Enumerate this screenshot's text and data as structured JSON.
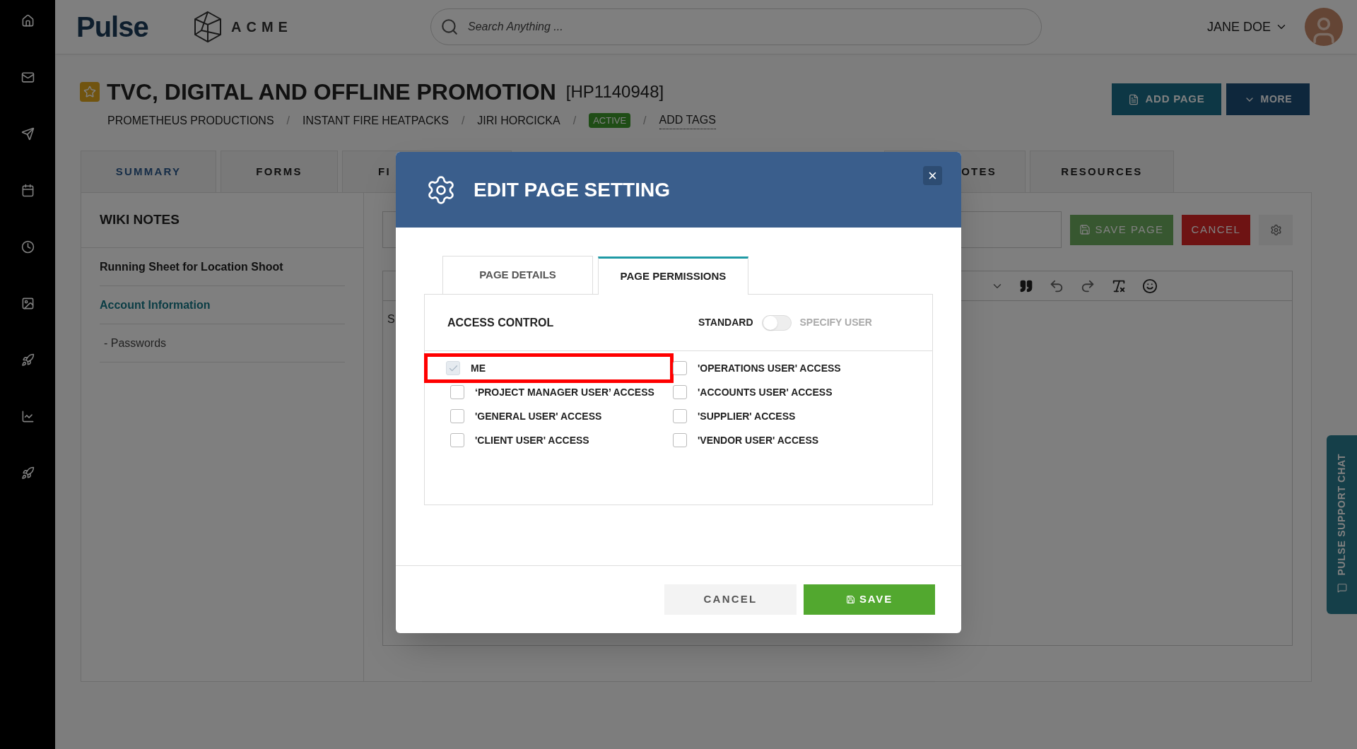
{
  "header": {
    "logo": "Pulse",
    "brand": "ACME",
    "search": {
      "placeholder": "Search Anything ..."
    },
    "user": "JANE DOE"
  },
  "page": {
    "title": "TVC, DIGITAL AND OFFLINE PROMOTION",
    "code": "[HP1140948]",
    "separator": "/",
    "breadcrumbs": [
      {
        "kind": "text",
        "label": "PROMETHEUS PRODUCTIONS"
      },
      {
        "kind": "text",
        "label": "INSTANT FIRE HEATPACKS"
      },
      {
        "kind": "text",
        "label": "JIRI HORCICKA"
      },
      {
        "kind": "badge",
        "label": "ACTIVE"
      },
      {
        "kind": "link",
        "label": "ADD TAGS"
      }
    ],
    "actions": [
      "ADD PAGE",
      "MORE"
    ]
  },
  "tabs": [
    {
      "label": "SUMMARY",
      "selected": true,
      "kind": "full"
    },
    {
      "label": "FORMS",
      "selected": false,
      "kind": "full"
    },
    {
      "label": "FI",
      "selected": false,
      "kind": "cut-right"
    },
    {
      "label": "OTES",
      "selected": false,
      "kind": "cut-left"
    },
    {
      "label": "RESOURCES",
      "selected": false,
      "kind": "full"
    }
  ],
  "wiki": {
    "title": "WIKI NOTES",
    "items": [
      {
        "label": "Running Sheet for Location Shoot",
        "selected": false
      },
      {
        "label": "Account Information",
        "selected": true
      },
      {
        "label": "- Passwords",
        "selected": false
      }
    ]
  },
  "editor": {
    "buttons": [
      "SAVE PAGE",
      "CANCEL"
    ],
    "body_text": "S"
  },
  "dialog": {
    "title": "EDIT PAGE SETTING",
    "close": "×",
    "tabs": [
      {
        "label": "PAGE DETAILS",
        "selected": false
      },
      {
        "label": "PAGE PERMISSIONS",
        "selected": true
      }
    ],
    "access_control": {
      "label": "ACCESS CONTROL",
      "left_option": "STANDARD",
      "right_option": "SPECIFY USER",
      "on": false
    },
    "options": [
      {
        "label": "ME",
        "checked": true,
        "disabled": true,
        "highlighted": true
      },
      {
        "label": "'OPERATIONS USER' ACCESS",
        "checked": false,
        "disabled": false,
        "highlighted": false
      },
      {
        "label": "‘PROJECT MANAGER USER’ ACCESS",
        "checked": false,
        "disabled": false,
        "highlighted": false
      },
      {
        "label": "'ACCOUNTS USER' ACCESS",
        "checked": false,
        "disabled": false,
        "highlighted": false
      },
      {
        "label": "'GENERAL USER' ACCESS",
        "checked": false,
        "disabled": false,
        "highlighted": false
      },
      {
        "label": "'SUPPLIER' ACCESS",
        "checked": false,
        "disabled": false,
        "highlighted": false
      },
      {
        "label": "'CLIENT USER' ACCESS",
        "checked": false,
        "disabled": false,
        "highlighted": false
      },
      {
        "label": "'VENDOR USER' ACCESS",
        "checked": false,
        "disabled": false,
        "highlighted": false
      }
    ],
    "buttons": [
      "CANCEL",
      "SAVE"
    ]
  },
  "chat": {
    "label": "PULSE SUPPORT CHAT"
  }
}
